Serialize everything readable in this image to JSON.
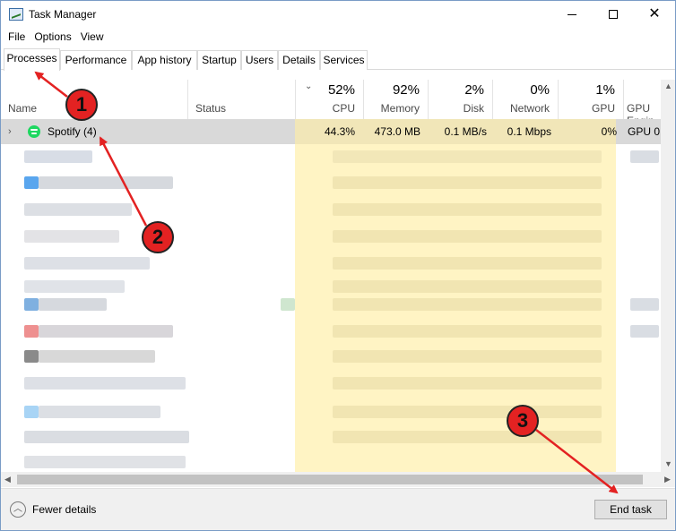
{
  "window": {
    "title": "Task Manager"
  },
  "menu": [
    "File",
    "Options",
    "View"
  ],
  "tabs": [
    "Processes",
    "Performance",
    "App history",
    "Startup",
    "Users",
    "Details",
    "Services"
  ],
  "columns": {
    "name": "Name",
    "status": "Status",
    "cpu": {
      "pct": "52%",
      "label": "CPU"
    },
    "memory": {
      "pct": "92%",
      "label": "Memory"
    },
    "disk": {
      "pct": "2%",
      "label": "Disk"
    },
    "network": {
      "pct": "0%",
      "label": "Network"
    },
    "gpu": {
      "pct": "1%",
      "label": "GPU"
    },
    "gpu_engine": "GPU Engin"
  },
  "selected_process": {
    "name": "Spotify (4)",
    "cpu": "44.3%",
    "memory": "473.0 MB",
    "disk": "0.1 MB/s",
    "network": "0.1 Mbps",
    "gpu": "0%",
    "gpu_engine": "GPU 0"
  },
  "footer": {
    "fewer_details": "Fewer details",
    "end_task": "End task"
  },
  "callouts": [
    "1",
    "2",
    "3"
  ],
  "colors": {
    "heat": "#fff4c4",
    "callout": "#e32222",
    "arrow": "#e32222",
    "selected_row": "#d9d9d9"
  }
}
